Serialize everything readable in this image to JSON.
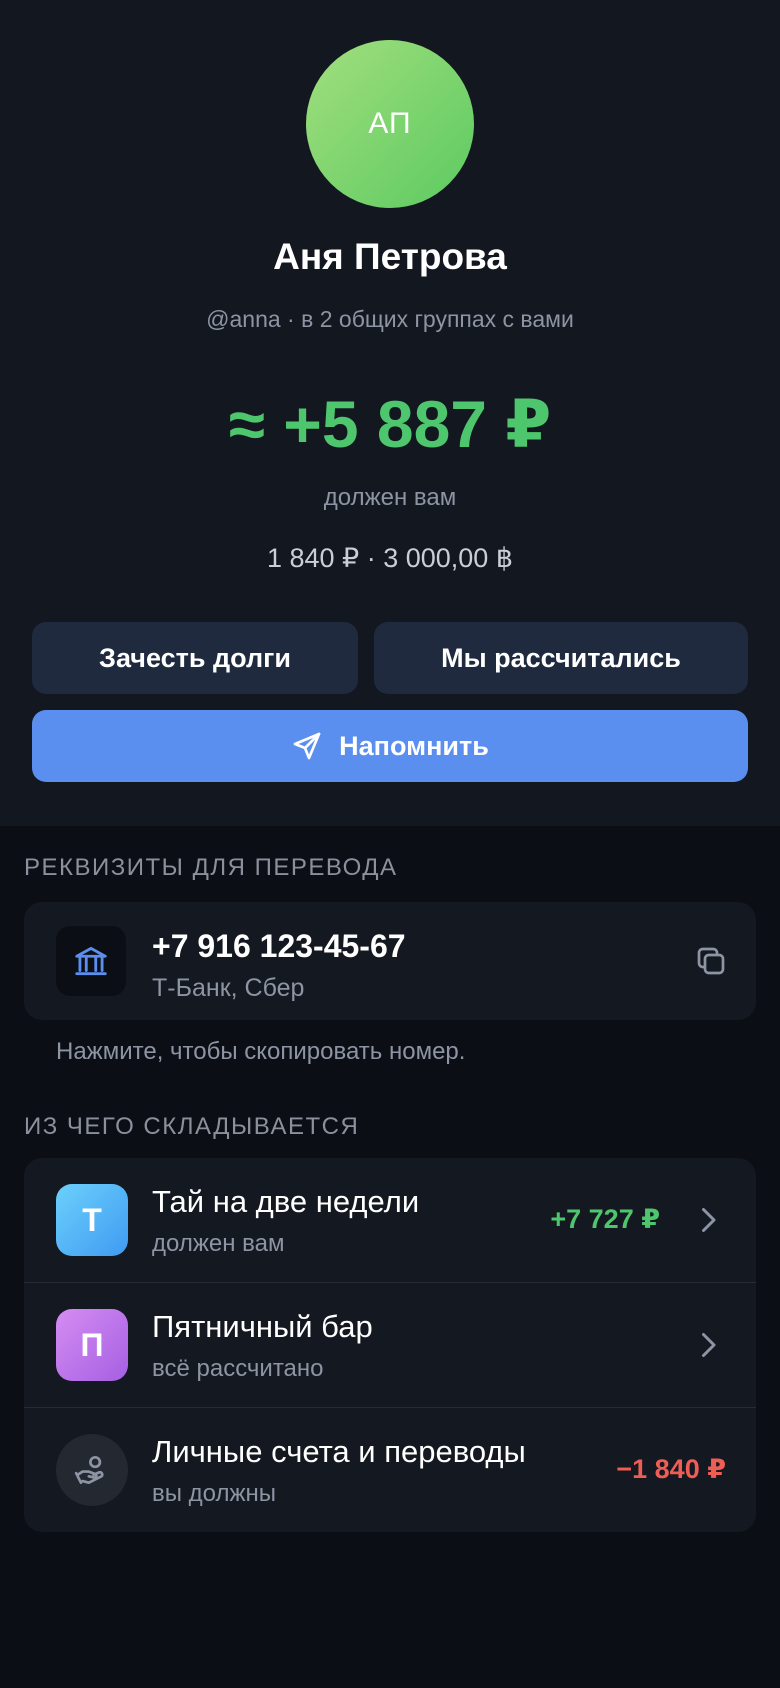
{
  "profile": {
    "avatar_initials": "АП",
    "name": "Аня Петрова",
    "subline": "@anna · в 2 общих группах с вами",
    "balance": "≈ +5 887 ₽",
    "balance_caption": "должен вам",
    "breakdown": "1 840 ₽ · 3 000,00 ฿"
  },
  "actions": {
    "offset_label": "Зачесть долги",
    "settled_label": "Мы рассчитались",
    "remind_label": "Напомнить"
  },
  "requisites": {
    "section_title": "РЕКВИЗИТЫ ДЛЯ ПЕРЕВОДА",
    "phone": "+7 916 123-45-67",
    "banks": "Т-Банк, Сбер",
    "hint": "Нажмите, чтобы скопировать номер."
  },
  "composition": {
    "section_title": "ИЗ ЧЕГО СКЛАДЫВАЕТСЯ",
    "items": [
      {
        "icon_letter": "Т",
        "title": "Тай на две недели",
        "status": "должен вам",
        "amount": "+7 727 ₽"
      },
      {
        "icon_letter": "П",
        "title": "Пятничный бар",
        "status": "всё рассчитано",
        "amount": ""
      },
      {
        "icon": "hand-coin-icon",
        "title": "Личные счета и переводы",
        "status": "вы должны",
        "amount": "−1 840 ₽"
      }
    ]
  },
  "colors": {
    "positive": "#4ec66d",
    "negative": "#ef5d55",
    "accent": "#5b8fef"
  }
}
